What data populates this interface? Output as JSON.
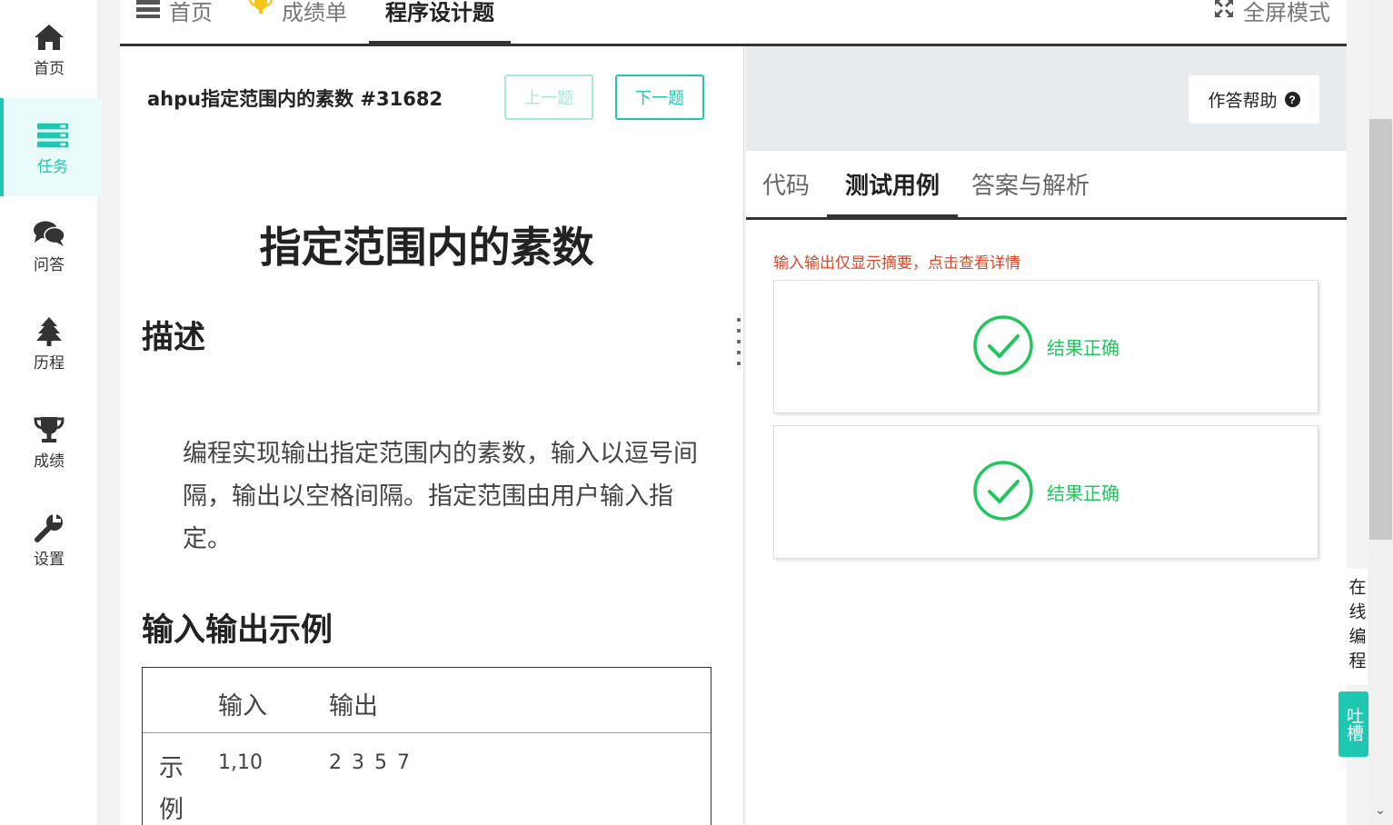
{
  "sidebar": {
    "items": [
      {
        "label": "首页",
        "icon": "home-icon"
      },
      {
        "label": "任务",
        "icon": "tasks-icon",
        "active": true
      },
      {
        "label": "问答",
        "icon": "chat-icon"
      },
      {
        "label": "历程",
        "icon": "tree-icon"
      },
      {
        "label": "成绩",
        "icon": "trophy-icon"
      },
      {
        "label": "设置",
        "icon": "wrench-icon"
      }
    ]
  },
  "topbar": {
    "tabs": [
      {
        "label": "首页",
        "icon": "server-icon"
      },
      {
        "label": "成绩单",
        "icon": "trophy-icon"
      },
      {
        "label": "程序设计题",
        "active": true
      }
    ],
    "fullscreen_label": "全屏模式"
  },
  "problem": {
    "header": "ahpu指定范围内的素数 #31682",
    "prev_label": "上一题",
    "next_label": "下一题",
    "title": "指定范围内的素数",
    "desc_heading": "描述",
    "description": "编程实现输出指定范围内的素数，输入以逗号间隔，输出以空格间隔。指定范围由用户输入指定。",
    "io_heading": "输入输出示例",
    "io_table": {
      "col_input": "输入",
      "col_output": "输出",
      "rows": [
        {
          "label": "示例",
          "input": "1,10",
          "output": "2 3 5 7"
        }
      ]
    }
  },
  "right": {
    "help_label": "作答帮助",
    "tabs": [
      {
        "label": "代码"
      },
      {
        "label": "测试用例",
        "active": true
      },
      {
        "label": "答案与解析"
      }
    ],
    "notice": "输入输出仅显示摘要，点击查看详情",
    "cases": [
      {
        "result": "结果正确"
      },
      {
        "result": "结果正确"
      }
    ]
  },
  "widgets": {
    "online_code": "在线编程",
    "feedback": "吐槽"
  },
  "colors": {
    "accent": "#1ec8b0",
    "success": "#22c55e",
    "notice": "#d9482b"
  }
}
